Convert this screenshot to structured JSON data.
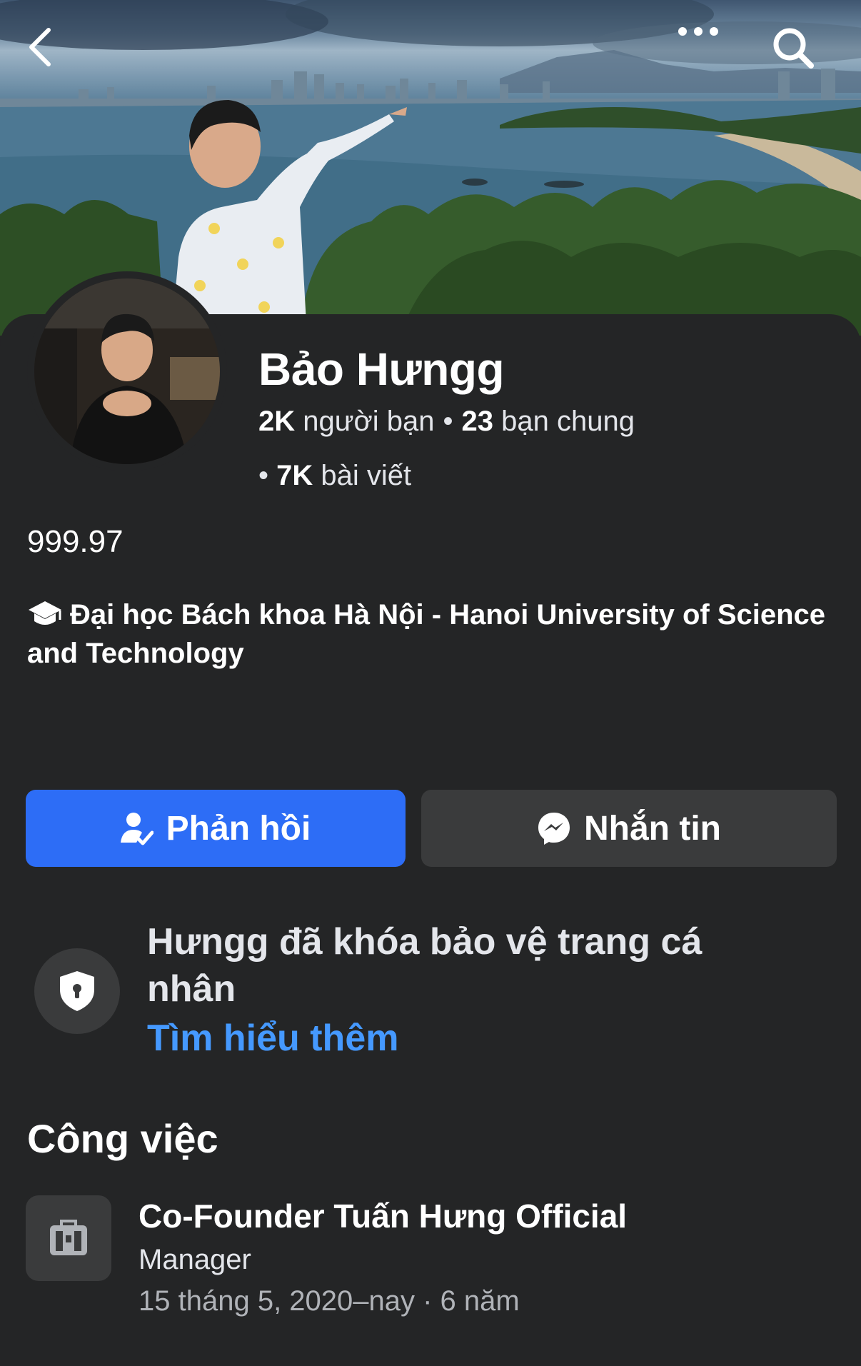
{
  "icons": {
    "back": "chevron-left-icon",
    "more": "more-horizontal-icon",
    "search": "search-icon",
    "education": "graduation-cap-icon",
    "respond": "person-check-icon",
    "message": "messenger-icon",
    "lock": "shield-lock-icon",
    "work": "briefcase-icon"
  },
  "profile": {
    "name": "Bảo Hưngg",
    "friends_count": "2K",
    "friends_label": "người bạn",
    "separator": "•",
    "mutual_count": "23",
    "mutual_label": "bạn chung",
    "posts_prefix": "•",
    "posts_count": "7K",
    "posts_label": "bài viết",
    "bio": "999.97",
    "education": "Đại học Bách khoa Hà Nội - Hanoi University of Science and Technology"
  },
  "actions": {
    "respond_label": "Phản hồi",
    "message_label": "Nhắn tin"
  },
  "lock_notice": {
    "text": "Hưngg đã khóa bảo vệ trang cá nhân",
    "link": "Tìm hiểu thêm"
  },
  "work": {
    "section_title": "Công việc",
    "title": "Co-Founder Tuấn Hưng Official",
    "role": "Manager",
    "dates": "15 tháng 5, 2020–nay · 6 năm"
  },
  "colors": {
    "background": "#242526",
    "primary_button": "#2d6df6",
    "secondary_button": "#3a3b3c",
    "link": "#4599ff"
  }
}
